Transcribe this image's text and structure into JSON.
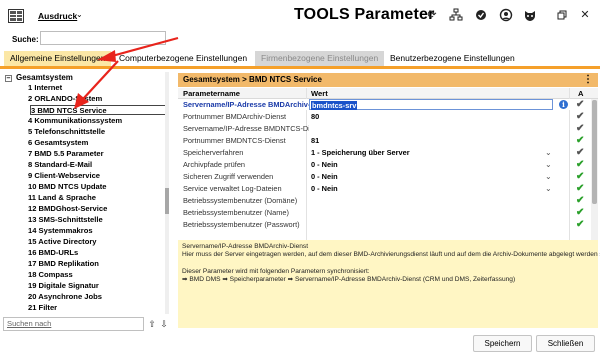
{
  "toolbar": {
    "print_label": "Ausdruck",
    "title": "TOOLS Parameter",
    "icons": [
      "refresh-icon",
      "network-icon",
      "settings-check-icon",
      "user-shield-icon",
      "mask-icon",
      "restore-icon",
      "close-icon"
    ]
  },
  "search": {
    "label": "Suche:",
    "value": ""
  },
  "tabs": [
    {
      "label": "Allgemeine Einstellungen",
      "state": "active"
    },
    {
      "label": "Computerbezogene Einstellungen",
      "state": "normal"
    },
    {
      "label": "Firmenbezogene Einstellungen",
      "state": "disabled"
    },
    {
      "label": "Benutzerbezogene Einstellungen",
      "state": "normal"
    }
  ],
  "tree": {
    "root": "Gesamtsystem",
    "items": [
      "1 Internet",
      "2 ORLANDO-System",
      "3 BMD NTCS Service",
      "4 Kommunikationssystem",
      "5 Telefonschnittstelle",
      "6 Gesamtsystem",
      "7 BMD 5.5 Parameter",
      "8 Standard-E-Mail",
      "9 Client-Webservice",
      "10 BMD NTCS Update",
      "11 Land & Sprache",
      "12 BMDGhost-Service",
      "13 SMS-Schnittstelle",
      "14 Systemmakros",
      "15 Active Directory",
      "16 BMD-URLs",
      "17 BMD Replikation",
      "18 Compass",
      "19 Digitale Signatur",
      "20 Asynchrone Jobs",
      "21 Filter"
    ],
    "selected_index": 2
  },
  "bottom_search": {
    "placeholder": "Suchen nach"
  },
  "panel": {
    "breadcrumb": "Gesamtsystem  >  BMD NTCS Service",
    "columns": {
      "name": "Parametername",
      "value": "Wert",
      "flag": "A"
    },
    "rows": [
      {
        "name": "Servername/IP-Adresse BMDArchiv-D",
        "value": "bmdntcs-srv",
        "selected": true,
        "check": "grey"
      },
      {
        "name": "Portnummer BMDArchiv-Dienst",
        "value": "80",
        "check": "grey"
      },
      {
        "name": "Servername/IP-Adresse BMDNTCS-Dienst",
        "value": "",
        "check": "grey"
      },
      {
        "name": "Portnummer BMDNTCS-Dienst",
        "value": "81",
        "check": "green"
      },
      {
        "name": "Speicherverfahren",
        "value": "1 - Speicherung über Server",
        "dropdown": true,
        "check": "grey"
      },
      {
        "name": "Archivpfade prüfen",
        "value": "0 - Nein",
        "dropdown": true,
        "check": "green"
      },
      {
        "name": "Sicheren Zugriff verwenden",
        "value": "0 - Nein",
        "dropdown": true,
        "check": "green"
      },
      {
        "name": "Service verwaltet Log-Dateien",
        "value": "0 - Nein",
        "dropdown": true,
        "check": "green"
      },
      {
        "name": "Betriebssystembenutzer (Domäne)",
        "value": "",
        "check": "green"
      },
      {
        "name": "Betriebssystembenutzer (Name)",
        "value": "",
        "check": "green"
      },
      {
        "name": "Betriebssystembenutzer (Passwort)",
        "value": "",
        "check": "green"
      }
    ]
  },
  "info": {
    "lines": [
      "Servername/IP-Adresse BMDArchiv-Dienst",
      "Hier muss der Server eingetragen werden, auf dem dieser BMD-Archivierungsdienst läuft und auf dem die Archiv-Dokumente abgelegt werden sollen.",
      "",
      "Dieser Parameter wird mit folgenden Parametern synchronisiert:",
      "   ➡ BMD DMS ➡ Speicherparameter ➡ Servername/IP-Adresse BMDArchiv-Dienst   (CRM und DMS, Zeiterfassung)"
    ]
  },
  "buttons": {
    "save": "Speichern",
    "close": "Schließen"
  },
  "colors": {
    "accent": "#f5a02a",
    "tab_active": "#fbe7a6",
    "panel_header": "#f2b96a",
    "info_bg": "#fff6c4",
    "annotation_arrow": "#e8241c"
  }
}
